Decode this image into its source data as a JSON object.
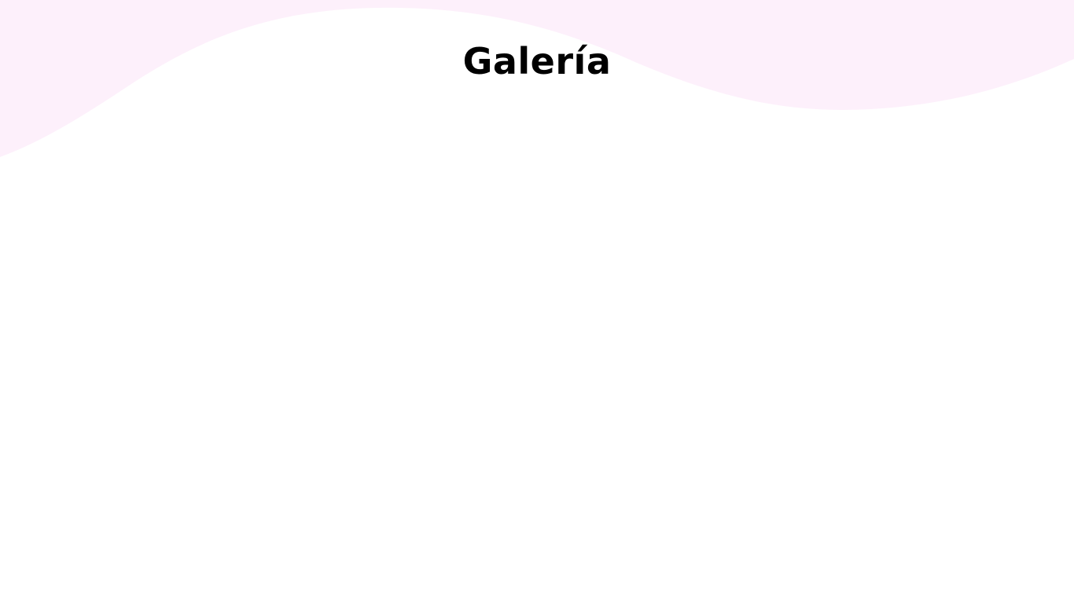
{
  "page": {
    "title": "Galería"
  },
  "colors": {
    "wave": "#fdf0fb",
    "background": "#ffffff",
    "title": "#000000"
  }
}
